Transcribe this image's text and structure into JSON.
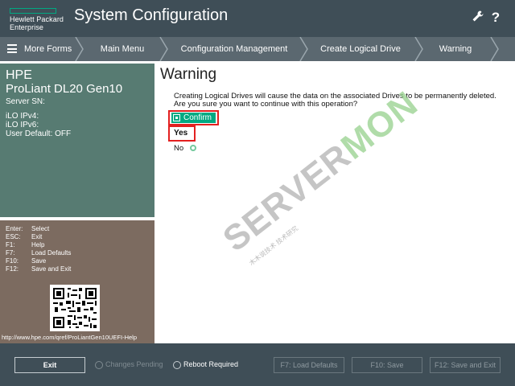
{
  "header": {
    "logo_line1": "Hewlett Packard",
    "logo_line2": "Enterprise",
    "title": "System Configuration",
    "settings_icon": "wrench-icon",
    "help_icon": "question-icon"
  },
  "breadcrumb": {
    "more_forms": "More Forms",
    "items": [
      "Main Menu",
      "Configuration Management",
      "Create Logical Drive",
      "Warning"
    ]
  },
  "system": {
    "brand": "HPE",
    "model": "ProLiant DL20 Gen10",
    "serial": "Server SN:",
    "ipv4": "iLO IPv4:",
    "ipv6": "iLO IPv6:",
    "user_default": "User Default: OFF"
  },
  "keys": [
    {
      "key": "Enter:",
      "action": "Select"
    },
    {
      "key": "ESC:",
      "action": "Exit"
    },
    {
      "key": "F1:",
      "action": "Help"
    },
    {
      "key": "F7:",
      "action": "Load Defaults"
    },
    {
      "key": "F10:",
      "action": "Save"
    },
    {
      "key": "F12:",
      "action": "Save and Exit"
    }
  ],
  "help_url": "http://www.hpe.com/qref/ProLiantGen10UEFI-Help",
  "main": {
    "title": "Warning",
    "message": "Creating Logical Drives will cause the data on the associated Drives to be permanently deleted. Are you sure you want to continue with this operation?",
    "confirm_label": "Confirm",
    "yes_label": "Yes",
    "no_label": "No"
  },
  "watermark": {
    "text_a": "SERVER",
    "text_b": "MON",
    "sub": "木木说技术 技术研究"
  },
  "footer": {
    "exit": "Exit",
    "changes_pending": "Changes Pending",
    "reboot_required": "Reboot Required",
    "load_defaults": "F7: Load Defaults",
    "save": "F10: Save",
    "save_exit": "F12: Save and Exit"
  },
  "colors": {
    "accent": "#01a982",
    "highlight": "#e32020",
    "header_bg": "#3f4e57",
    "system_panel": "#577b72",
    "help_panel": "#7c6b60"
  }
}
